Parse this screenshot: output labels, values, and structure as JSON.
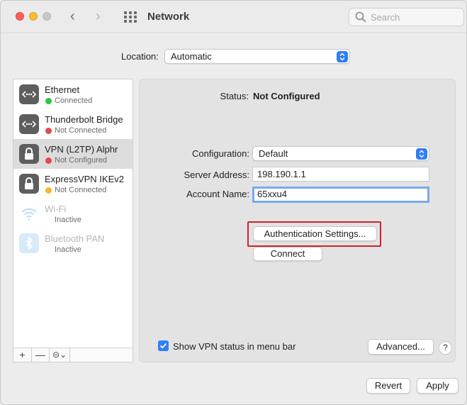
{
  "window": {
    "title": "Network"
  },
  "search": {
    "placeholder": "Search"
  },
  "location": {
    "label": "Location:",
    "value": "Automatic"
  },
  "services": [
    {
      "name": "Ethernet",
      "status": "Connected",
      "status_color": "#28c840",
      "icon": "ethernet-icon",
      "selected": false,
      "faded": false
    },
    {
      "name": "Thunderbolt Bridge",
      "status": "Not Connected",
      "status_color": "#e5484d",
      "icon": "ethernet-icon",
      "selected": false,
      "faded": false
    },
    {
      "name": "VPN (L2TP) Alphr",
      "status": "Not Configured",
      "status_color": "#e5484d",
      "icon": "lock-icon",
      "selected": true,
      "faded": false
    },
    {
      "name": "ExpressVPN IKEv2",
      "status": "Not Connected",
      "status_color": "#f5b82e",
      "icon": "lock-icon",
      "selected": false,
      "faded": false
    },
    {
      "name": "Wi-Fi",
      "status": "Inactive",
      "status_color": null,
      "icon": "wifi-icon",
      "selected": false,
      "faded": true
    },
    {
      "name": "Bluetooth PAN",
      "status": "Inactive",
      "status_color": null,
      "icon": "bluetooth-icon",
      "selected": false,
      "faded": true
    }
  ],
  "sidebar_bar": {
    "add": "+",
    "remove": "—",
    "action": "⊝⌄"
  },
  "detail": {
    "status_label": "Status:",
    "status_value": "Not Configured",
    "configuration_label": "Configuration:",
    "configuration_value": "Default",
    "server_label": "Server Address:",
    "server_value": "198.190.1.1",
    "account_label": "Account Name:",
    "account_value": "65xxu4",
    "auth_button": "Authentication Settings...",
    "connect_button": "Connect",
    "show_status_label": "Show VPN status in menu bar",
    "show_status_checked": true,
    "advanced_button": "Advanced...",
    "help_button": "?"
  },
  "footer": {
    "revert": "Revert",
    "apply": "Apply"
  },
  "colors": {
    "accent": "#2f7ff6",
    "highlight": "#d0212a"
  }
}
